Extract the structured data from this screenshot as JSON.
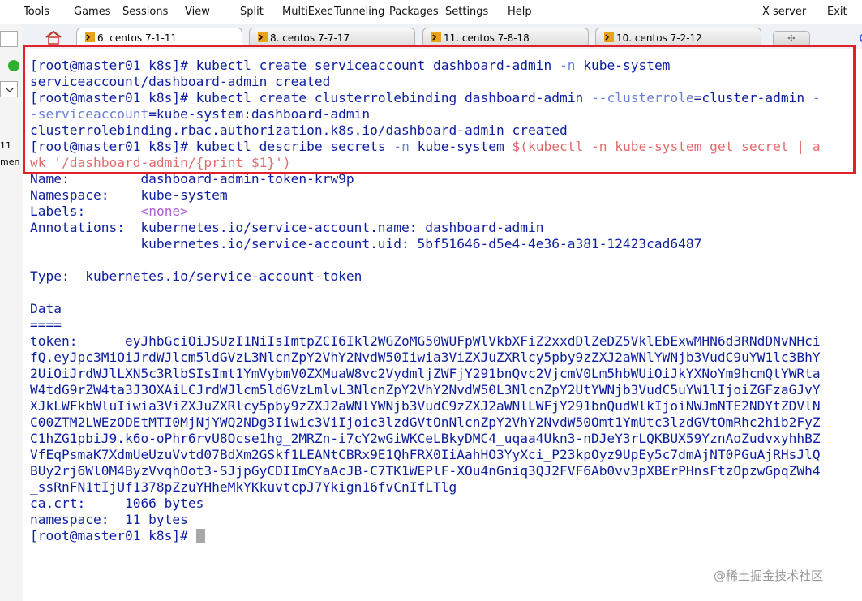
{
  "menu": {
    "tools": "Tools",
    "games": "Games",
    "sessions": "Sessions",
    "view": "View",
    "split": "Split",
    "multiexec": "MultiExec",
    "tunneling": "Tunneling",
    "packages": "Packages",
    "settings": "Settings",
    "help": "Help",
    "xserver": "X server",
    "exit": "Exit"
  },
  "left_panel": {
    "text1": "11",
    "text2": "men"
  },
  "tabs": [
    {
      "label": "6. centos 7-1-11",
      "active": true
    },
    {
      "label": "8. centos 7-7-17",
      "active": false
    },
    {
      "label": "11. centos 7-8-18",
      "active": false
    },
    {
      "label": "10. centos 7-2-12",
      "active": false
    }
  ],
  "newtab_icon": "plus-icon",
  "terminal": {
    "prompt": "[root@master01 k8s]# ",
    "l1_cmd": "kubectl create serviceaccount dashboard-admin ",
    "l1_flag": "-n",
    "l1_rest": " kube-system",
    "l2": "serviceaccount/dashboard-admin created",
    "l3_cmd": "kubectl create clusterrolebinding dashboard-admin ",
    "l3_flag": "--clusterrole",
    "l3_rest": "=cluster-admin ",
    "l3_dash": "-",
    "l4_flag": "-serviceaccount",
    "l4_rest": "=kube-system:dashboard-admin",
    "l5": "clusterrolebinding.rbac.authorization.k8s.io/dashboard-admin created",
    "l6_cmd": "kubectl describe secrets ",
    "l6_flag": "-n",
    "l6_mid": " kube-system ",
    "l6_sub": "$(kubectl -n kube-system get secret | a",
    "l7": "wk '/dashboard-admin/{print $1}')",
    "l8": "Name:         dashboard-admin-token-krw9p",
    "l9": "Namespace:    kube-system",
    "l10_key": "Labels:       ",
    "l10_val": "<none>",
    "l11": "Annotations:  kubernetes.io/service-account.name: dashboard-admin",
    "l12": "              kubernetes.io/service-account.uid: 5bf51646-d5e4-4e36-a381-12423cad6487",
    "l14": "Type:  kubernetes.io/service-account-token",
    "l16": "Data",
    "l17": "====",
    "token_lines": [
      "token:      eyJhbGciOiJSUzI1NiIsImtpZCI6Ikl2WGZoMG50WUFpWlVkbXFiZ2xxdDlZeDZ5VklEbExwMHN6d3RNdDNvNHci",
      "fQ.eyJpc3MiOiJrdWJlcm5ldGVzL3NlcnZpY2VhY2NvdW50Iiwia3ViZXJuZXRlcy5pby9zZXJ2aWNlYWNjb3VudC9uYW1lc3BhY",
      "2UiOiJrdWJlLXN5c3RlbSIsImt1YmVybmV0ZXMuaW8vc2VydmljZWFjY291bnQvc2VjcmV0Lm5hbWUiOiJkYXNoYm9hcmQtYWRta",
      "W4tdG9rZW4ta3J3OXAiLCJrdWJlcm5ldGVzLmlvL3NlcnZpY2VhY2NvdW50L3NlcnZpY2UtYWNjb3VudC5uYW1lIjoiZGFzaGJvY",
      "XJkLWFkbWluIiwia3ViZXJuZXRlcy5pby9zZXJ2aWNlYWNjb3VudC9zZXJ2aWNlLWFjY291bnQudWlkIjoiNWJmNTE2NDYtZDVlN",
      "C00ZTM2LWEzODEtMTI0MjNjYWQ2NDg3Iiwic3ViIjoic3lzdGVtOnNlcnZpY2VhY2NvdW50Omt1YmUtc3lzdGVtOmRhc2hib2FyZ",
      "C1hZG1pbiJ9.k6o-oPhr6rvU8Ocse1hg_2MRZn-i7cY2wGiWKCeLBkyDMC4_uqaa4Ukn3-nDJeY3rLQKBUX59YznAoZudvxyhhBZ",
      "VfEqPsmaK7XdmUeUzuVvtd07BdXm2GSkf1LEANtCBRx9E1QhFRX0IiAahHO3YyXci_P23kpOyz9UpEy5c7dmAjNT0PGuAjRHsJlQ",
      "BUy2rj6Wl0M4ByzVvqhOot3-SJjpGyCDIImCYaAcJB-C7TK1WEPlF-XOu4nGniq3QJ2FVF6Ab0vv3pXBErPHnsFtzOpzwGpqZWh4",
      "_ssRnFN1tIjUf1378pZzuYHheMkYKkuvtcpJ7Ykign16fvCnIfLTlg"
    ],
    "ca_crt": "ca.crt:     1066 bytes",
    "namespace": "namespace:  11 bytes",
    "final_prompt": "[root@master01 k8s]# "
  },
  "watermark": "@稀土掘金技术社区",
  "colors": {
    "terminal_text": "#0d1fa0",
    "highlight": "#e0202a",
    "flag": "#6b7ed9",
    "subshell": "#e26b6b",
    "none": "#b05fd6"
  }
}
